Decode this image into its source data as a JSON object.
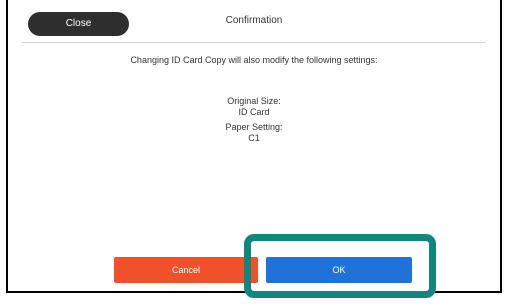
{
  "header": {
    "close_label": "Close",
    "title": "Confirmation"
  },
  "dialog": {
    "message": "Changing ID Card Copy will also modify the following settings:",
    "settings": [
      {
        "label": "Original Size:",
        "value": "ID Card"
      },
      {
        "label": "Paper Setting:",
        "value": "C1"
      }
    ]
  },
  "buttons": {
    "cancel_label": "Cancel",
    "ok_label": "OK"
  },
  "colors": {
    "close_button": "#2e2e2e",
    "cancel_button": "#f0502a",
    "ok_button": "#1f73d8",
    "highlight": "#11867c"
  }
}
